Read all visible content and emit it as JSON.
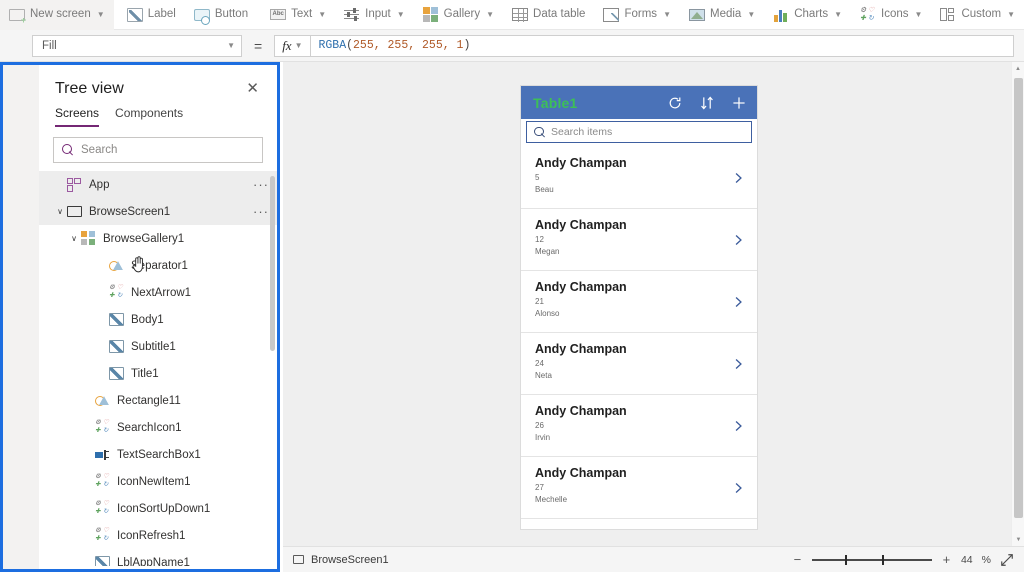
{
  "toolbar": {
    "items": [
      {
        "label": "New screen",
        "icon": "new-screen-icon",
        "caret": true
      },
      {
        "label": "Label",
        "icon": "label-icon",
        "caret": false
      },
      {
        "label": "Button",
        "icon": "button-icon",
        "caret": false
      },
      {
        "label": "Text",
        "icon": "text-icon",
        "caret": true
      },
      {
        "label": "Input",
        "icon": "input-icon",
        "caret": true
      },
      {
        "label": "Gallery",
        "icon": "gallery-icon",
        "caret": true
      },
      {
        "label": "Data table",
        "icon": "data-table-icon",
        "caret": false
      },
      {
        "label": "Forms",
        "icon": "forms-icon",
        "caret": true
      },
      {
        "label": "Media",
        "icon": "media-icon",
        "caret": true
      },
      {
        "label": "Charts",
        "icon": "charts-icon",
        "caret": true
      },
      {
        "label": "Icons",
        "icon": "icons-icon",
        "caret": true
      },
      {
        "label": "Custom",
        "icon": "custom-icon",
        "caret": true
      }
    ]
  },
  "formula_bar": {
    "property": "Fill",
    "equals": "=",
    "fx_label": "fx",
    "formula_function": "RGBA",
    "formula_open": "(",
    "formula_args": "255, 255, 255, 1",
    "formula_close": ")"
  },
  "left_rail": {
    "items": [
      {
        "name": "hamburger-menu",
        "selected": false
      },
      {
        "name": "tree-view",
        "selected": true
      },
      {
        "name": "insert",
        "selected": false
      },
      {
        "name": "data-sources",
        "selected": false
      },
      {
        "name": "media",
        "selected": false
      },
      {
        "name": "variables",
        "selected": false
      }
    ]
  },
  "tree_view": {
    "title": "Tree view",
    "close_label": "✕",
    "tabs": [
      {
        "label": "Screens",
        "active": true
      },
      {
        "label": "Components",
        "active": false
      }
    ],
    "search_placeholder": "Search",
    "overflow_label": "···",
    "items": [
      {
        "label": "App",
        "icon": "app-icon",
        "indent": 0,
        "caret": "",
        "menu": true,
        "selected": true
      },
      {
        "label": "BrowseScreen1",
        "icon": "screen-icon",
        "indent": 0,
        "caret": "∨",
        "menu": true,
        "selected": true
      },
      {
        "label": "BrowseGallery1",
        "icon": "gallery-icon",
        "indent": 1,
        "caret": "∨",
        "menu": false,
        "selected": false
      },
      {
        "label": "Separator1",
        "icon": "shape-icon",
        "indent": 2,
        "caret": "",
        "menu": false,
        "selected": false
      },
      {
        "label": "NextArrow1",
        "icon": "icon-control-icon",
        "indent": 2,
        "caret": "",
        "menu": false,
        "selected": false
      },
      {
        "label": "Body1",
        "icon": "label-icon",
        "indent": 2,
        "caret": "",
        "menu": false,
        "selected": false
      },
      {
        "label": "Subtitle1",
        "icon": "label-icon",
        "indent": 2,
        "caret": "",
        "menu": false,
        "selected": false
      },
      {
        "label": "Title1",
        "icon": "label-icon",
        "indent": 2,
        "caret": "",
        "menu": false,
        "selected": false
      },
      {
        "label": "Rectangle11",
        "icon": "shape-icon",
        "indent": 1,
        "caret": "",
        "menu": false,
        "selected": false
      },
      {
        "label": "SearchIcon1",
        "icon": "icon-control-icon",
        "indent": 1,
        "caret": "",
        "menu": false,
        "selected": false
      },
      {
        "label": "TextSearchBox1",
        "icon": "textbox-icon",
        "indent": 1,
        "caret": "",
        "menu": false,
        "selected": false
      },
      {
        "label": "IconNewItem1",
        "icon": "icon-control-icon",
        "indent": 1,
        "caret": "",
        "menu": false,
        "selected": false
      },
      {
        "label": "IconSortUpDown1",
        "icon": "icon-control-icon",
        "indent": 1,
        "caret": "",
        "menu": false,
        "selected": false
      },
      {
        "label": "IconRefresh1",
        "icon": "icon-control-icon",
        "indent": 1,
        "caret": "",
        "menu": false,
        "selected": false
      },
      {
        "label": "LblAppName1",
        "icon": "label-icon",
        "indent": 1,
        "caret": "",
        "menu": false,
        "selected": false
      }
    ]
  },
  "app_preview": {
    "header": {
      "title": "Table1",
      "title_color": "#3dbf57",
      "background_color": "#4a72b8",
      "icons": [
        {
          "name": "refresh-icon"
        },
        {
          "name": "sort-icon"
        },
        {
          "name": "add-icon"
        }
      ]
    },
    "search_placeholder": "Search items",
    "gallery_items": [
      {
        "title": "Andy Champan",
        "subtitle": "5",
        "body": "Beau"
      },
      {
        "title": "Andy Champan",
        "subtitle": "12",
        "body": "Megan"
      },
      {
        "title": "Andy Champan",
        "subtitle": "21",
        "body": "Alonso"
      },
      {
        "title": "Andy Champan",
        "subtitle": "24",
        "body": "Neta"
      },
      {
        "title": "Andy Champan",
        "subtitle": "26",
        "body": "Irvin"
      },
      {
        "title": "Andy Champan",
        "subtitle": "27",
        "body": "Mechelle"
      }
    ]
  },
  "status_bar": {
    "screen_name": "BrowseScreen1",
    "zoom_minus": "−",
    "zoom_plus": "+",
    "zoom_value": "44",
    "zoom_unit": "%"
  },
  "colors": {
    "panel_focus_border": "#1d6ee0",
    "tab_accent": "#742774",
    "app_header": "#4a72b8",
    "app_title": "#3dbf57",
    "chevron": "#3a5a9a",
    "canvas_bg": "#efefef"
  }
}
